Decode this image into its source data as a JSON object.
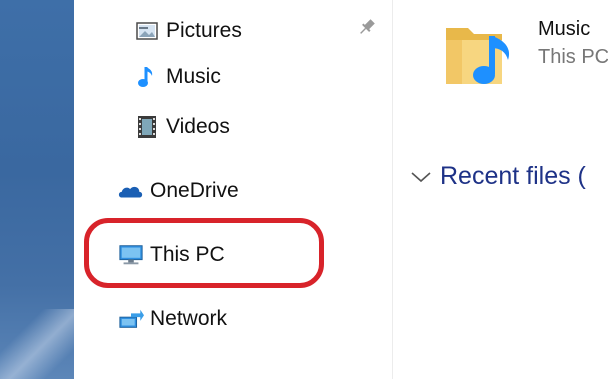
{
  "nav": {
    "items": [
      {
        "label": "Pictures",
        "icon": "pictures-icon"
      },
      {
        "label": "Music",
        "icon": "music-icon"
      },
      {
        "label": "Videos",
        "icon": "videos-icon"
      },
      {
        "label": "OneDrive",
        "icon": "onedrive-icon"
      },
      {
        "label": "This PC",
        "icon": "this-pc-icon"
      },
      {
        "label": "Network",
        "icon": "network-icon"
      }
    ],
    "pinned_icon": "pin-icon",
    "highlighted_item": "This PC"
  },
  "content": {
    "tile": {
      "name": "Music",
      "subtitle": "This PC",
      "icon": "music-folder-icon"
    },
    "section": {
      "title": "Recent files (",
      "expander_icon": "chevron-down-icon"
    }
  },
  "colors": {
    "highlight": "#d8232a",
    "section_title": "#1e3287",
    "accent": "#1e90ff",
    "desktop": "#3e6fa8"
  }
}
